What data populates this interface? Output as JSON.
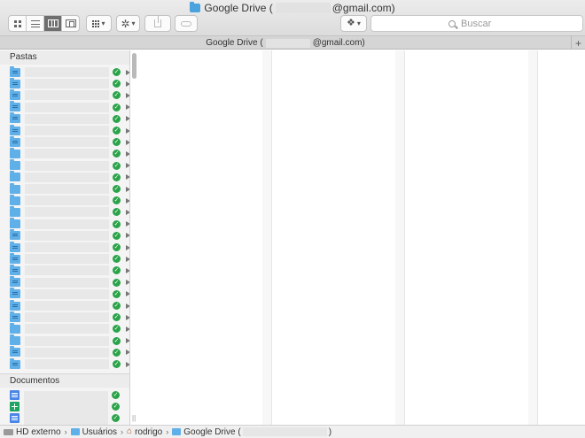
{
  "window": {
    "title_prefix": "Google Drive (",
    "title_suffix": "@gmail.com)"
  },
  "toolbar": {
    "search_placeholder": "Buscar",
    "icons": [
      "icon-view-icon",
      "list-view-icon",
      "column-view-icon",
      "cover-flow-icon",
      "arrange-icon",
      "gear-icon",
      "share-icon",
      "tag-icon",
      "dropbox-icon",
      "search-icon"
    ]
  },
  "tab": {
    "prefix": "Google Drive (",
    "suffix": "@gmail.com)",
    "add_label": "+"
  },
  "sidebar": {
    "folders_header": "Pastas",
    "documents_header": "Documentos",
    "check_glyph": "✓",
    "resize_glyph": "||"
  },
  "pathbar": {
    "items": [
      {
        "label": "HD externo",
        "icon": "disk-icon"
      },
      {
        "label": "Usuários",
        "icon": "folder-icon"
      },
      {
        "label": "rodrigo",
        "icon": "home-icon"
      },
      {
        "label": "Google Drive (",
        "icon": "folder-icon"
      }
    ],
    "separator": "›",
    "tail": ")"
  },
  "colors": {
    "folder": "#5fb0e8",
    "synced": "#2aa349",
    "doc": "#4a86e8",
    "sheet": "#1fa463"
  }
}
